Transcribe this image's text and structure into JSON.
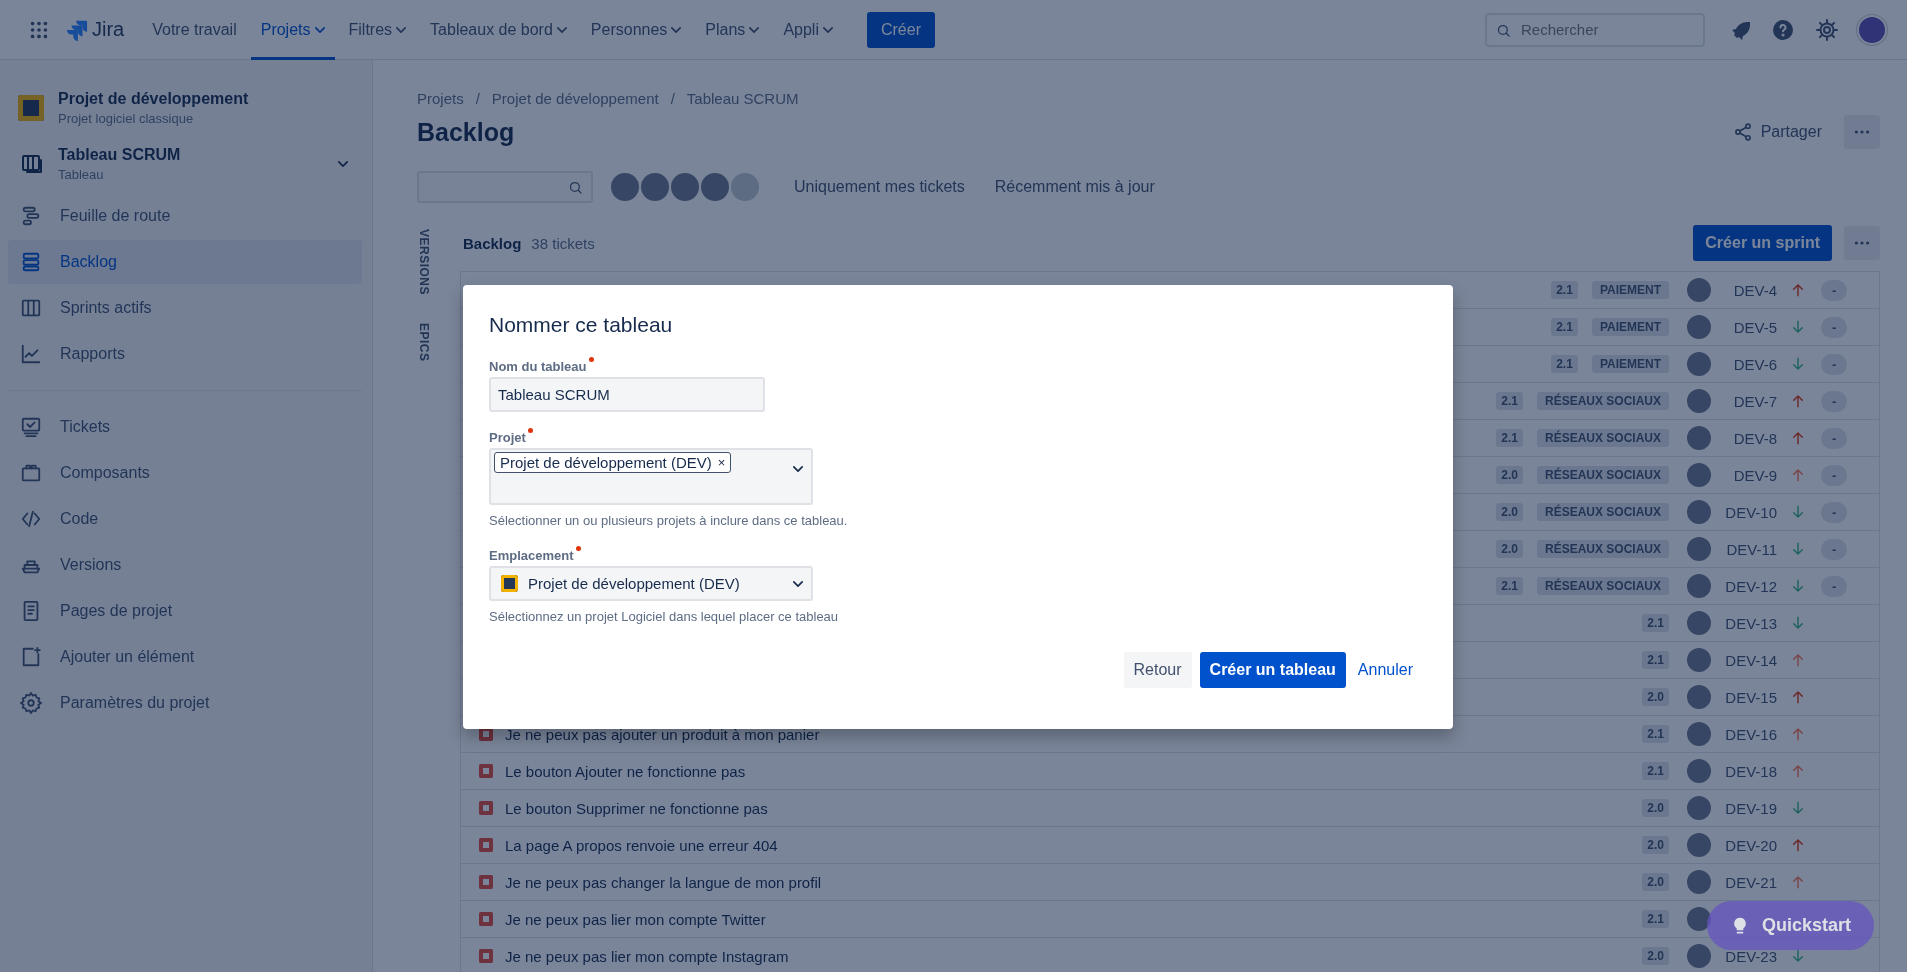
{
  "topnav": {
    "logo_text": "Jira",
    "nav": [
      {
        "label": "Votre travail",
        "dropdown": false,
        "selected": false
      },
      {
        "label": "Projets",
        "dropdown": true,
        "selected": true
      },
      {
        "label": "Filtres",
        "dropdown": true,
        "selected": false
      },
      {
        "label": "Tableaux de bord",
        "dropdown": true,
        "selected": false
      },
      {
        "label": "Personnes",
        "dropdown": true,
        "selected": false
      },
      {
        "label": "Plans",
        "dropdown": true,
        "selected": false
      },
      {
        "label": "Appli",
        "dropdown": true,
        "selected": false
      }
    ],
    "create_button": "Créer",
    "search": {
      "placeholder": "Rechercher"
    }
  },
  "sidebar": {
    "project": {
      "name": "Projet de développement",
      "type": "Projet logiciel classique"
    },
    "board": {
      "name": "Tableau SCRUM",
      "type": "Tableau"
    },
    "planning_items": [
      {
        "label": "Feuille de route",
        "kind": "roadmap",
        "selected": false
      },
      {
        "label": "Backlog",
        "kind": "backlog",
        "selected": true
      },
      {
        "label": "Sprints actifs",
        "kind": "board",
        "selected": false
      },
      {
        "label": "Rapports",
        "kind": "chart",
        "selected": false
      }
    ],
    "project_items": [
      {
        "label": "Tickets",
        "kind": "tickets",
        "selected": false
      },
      {
        "label": "Composants",
        "kind": "components",
        "selected": false
      },
      {
        "label": "Code",
        "kind": "code",
        "selected": false
      },
      {
        "label": "Versions",
        "kind": "ship",
        "selected": false
      },
      {
        "label": "Pages de projet",
        "kind": "page",
        "selected": false
      },
      {
        "label": "Ajouter un élément",
        "kind": "add",
        "selected": false
      },
      {
        "label": "Paramètres du projet",
        "kind": "gear",
        "selected": false
      }
    ]
  },
  "breadcrumbs": [
    {
      "label": "Projets"
    },
    {
      "separator": "/",
      "label": "Projet de développement"
    },
    {
      "separator": "/",
      "label": "Tableau SCRUM"
    }
  ],
  "page_title": "Backlog",
  "share_button": "Partager",
  "quick_filters": [
    "Uniquement mes tickets",
    "Récemment mis à jour"
  ],
  "side_tabs": [
    "VERSIONS",
    "EPICS"
  ],
  "backlog": {
    "title": "Backlog",
    "count": "38 tickets",
    "create_sprint_button": "Créer un sprint",
    "rows": [
      {
        "version": "2.1",
        "epic": "PAIEMENT",
        "key": "DEV-4",
        "kind": "high",
        "status": "-"
      },
      {
        "version": "2.1",
        "epic": "PAIEMENT",
        "key": "DEV-5",
        "kind": "low",
        "status": "-"
      },
      {
        "version": "2.1",
        "epic": "PAIEMENT",
        "key": "DEV-6",
        "kind": "low",
        "status": "-"
      },
      {
        "version": "2.1",
        "epic": "RÉSEAUX SOCIAUX",
        "key": "DEV-7",
        "kind": "high",
        "status": "-"
      },
      {
        "version": "2.1",
        "epic": "RÉSEAUX SOCIAUX",
        "key": "DEV-8",
        "kind": "high",
        "status": "-"
      },
      {
        "version": "2.0",
        "epic": "RÉSEAUX SOCIAUX",
        "key": "DEV-9",
        "kind": "medium",
        "status": "-"
      },
      {
        "version": "2.0",
        "epic": "RÉSEAUX SOCIAUX",
        "key": "DEV-10",
        "kind": "low",
        "status": "-"
      },
      {
        "version": "2.0",
        "epic": "RÉSEAUX SOCIAUX",
        "key": "DEV-11",
        "kind": "low",
        "status": "-"
      },
      {
        "version": "2.1",
        "epic": "RÉSEAUX SOCIAUX",
        "key": "DEV-12",
        "kind": "low",
        "status": "-"
      },
      {
        "version": "2.1",
        "key": "DEV-13",
        "kind": "low"
      },
      {
        "version": "2.1",
        "key": "DEV-14",
        "kind": "medium"
      },
      {
        "version": "2.0",
        "key": "DEV-15",
        "kind": "high"
      },
      {
        "title": "Je ne peux pas ajouter un produit à mon panier",
        "version": "2.1",
        "key": "DEV-16",
        "kind": "medium"
      },
      {
        "title": "Le bouton Ajouter ne fonctionne pas",
        "version": "2.1",
        "key": "DEV-18",
        "kind": "medium"
      },
      {
        "title": "Le bouton Supprimer ne fonctionne pas",
        "version": "2.0",
        "key": "DEV-19",
        "kind": "low"
      },
      {
        "title": "La page A propos renvoie une erreur 404",
        "version": "2.0",
        "key": "DEV-20",
        "kind": "high"
      },
      {
        "title": "Je ne peux pas changer la langue de mon profil",
        "version": "2.0",
        "key": "DEV-21",
        "kind": "medium"
      },
      {
        "title": "Je ne peux pas lier mon compte Twitter",
        "version": "2.1"
      },
      {
        "title": "Je ne peux pas lier mon compte Instagram",
        "version": "2.0",
        "key": "DEV-23",
        "kind": "low"
      }
    ]
  },
  "dialog": {
    "title": "Nommer ce tableau",
    "board_name": {
      "label": "Nom du tableau",
      "required": true,
      "value": "Tableau SCRUM"
    },
    "project": {
      "label": "Projet",
      "required": true,
      "tags": [
        "Projet de développement (DEV)"
      ],
      "tag_remove": "×",
      "help": "Sélectionner un ou plusieurs projets à inclure dans ce tableau."
    },
    "location": {
      "label": "Emplacement",
      "required": true,
      "value": "Projet de développement (DEV)",
      "help": "Sélectionnez un projet Logiciel dans lequel placer ce tableau"
    },
    "buttons": [
      {
        "label": "Retour",
        "kind": "subtle"
      },
      {
        "label": "Créer un tableau",
        "kind": "primary"
      },
      {
        "label": "Annuler",
        "kind": "link"
      }
    ]
  },
  "quickstart": "Quickstart"
}
